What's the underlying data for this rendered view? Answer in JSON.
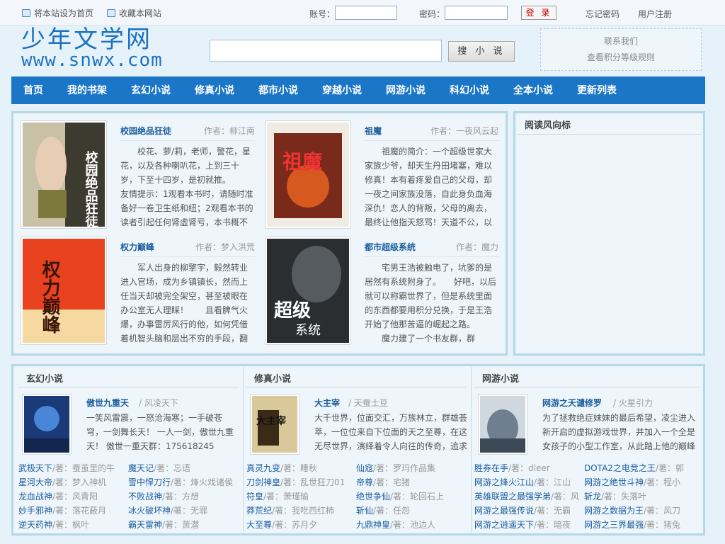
{
  "topbar": {
    "set_home": "将本站设为首页",
    "bookmark": "收藏本网站",
    "account_label": "账号：",
    "password_label": "密码：",
    "login": "登 录",
    "forgot": "忘记密码",
    "register": "用户注册"
  },
  "logo": {
    "cn": "少年文学网",
    "en": "www.snwx.com"
  },
  "search": {
    "value": "",
    "button": "搜 小 说"
  },
  "topright": {
    "line1": "联系我们",
    "line2": "查看积分等级规则"
  },
  "nav": [
    "首页",
    "我的书架",
    "玄幻小说",
    "修真小说",
    "都市小说",
    "穿越小说",
    "网游小说",
    "科幻小说",
    "全本小说",
    "更新列表"
  ],
  "featured": [
    {
      "title": "校园绝品狂徒",
      "author": "作者：柳江南",
      "desc": "　　校花、萝/莉，老师，警花，星花，以及各种喇叭花，上到三十岁，下至十四岁，是初就推。\n友情提示：1观看本书时，请随时准备好一卷卫生纸和纽；2观看本书的读者引起任何肾虚肾亏，本书概不"
    },
    {
      "title": "祖魔",
      "author": "作者：一夜风云起",
      "desc": "　　祖魔的简介：一个超级世家大家族少爷，却天生丹田堵塞，难以修真！本有着疼爱自己的父母，却一夜之间家族没落，自此身负血海深仇！恋人的背叛，父母的离去，最终让他指天怒骂！天道不公，以"
    },
    {
      "title": "权力巅峰",
      "author": "作者：梦入洪荒",
      "desc": "　　军人出身的柳擎宇，毅然转业进入官场，成为乡镇镇长，然而上任当天却被完全架空，甚至被眼在办公室无人理睬！　　且看脾气火爆，办事雷厉风行的他，如何凭借着机智头脑和层出不穷的手段，翻"
    },
    {
      "title": "都市超级系统",
      "author": "作者：魔力",
      "desc": "　　宅男王浩被触电了，坑爹的是居然有系统附身了。　　好吧，以后就可以称霸世界了，但是系统里面的东西都要用积分兑换，于是王浩开始了他那苦逼的崛起之路。\n　　魔力建了一个书友群，群"
    }
  ],
  "sidebar": {
    "title": "阅读风向标"
  },
  "sections": [
    {
      "title": "玄幻小说",
      "top": {
        "title": "傲世九重天",
        "author": "/ 风凌天下",
        "desc": "一笑风雷震，一怒沧海寒；一手破苍穹，一剑舞长天！ 一人一剑，傲世九重天！ 傲世一重天群：175618245（VIP订阅"
      },
      "list": [
        {
          "name": "武极天下",
          "author": "/著：蚕茧里的牛"
        },
        {
          "name": "魔天记",
          "author": "/著：忘语"
        },
        {
          "name": "星河大帝",
          "author": "/著：梦入神机"
        },
        {
          "name": "雪中悍刀行",
          "author": "/著：烽火戏诸侯"
        },
        {
          "name": "龙血战神",
          "author": "/著：风青阳"
        },
        {
          "name": "不败战神",
          "author": "/著：方想"
        },
        {
          "name": "妙手邪神",
          "author": "/著：落花蔽月"
        },
        {
          "name": "冰火破坏神",
          "author": "/著：无罪"
        },
        {
          "name": "逆天药神",
          "author": "/著：枫叶"
        },
        {
          "name": "霸天雷神",
          "author": "/著：萧潜"
        }
      ]
    },
    {
      "title": "修真小说",
      "top": {
        "title": "大主宰",
        "author": "/ 天蚕土豆",
        "desc": "大千世界，位面交汇，万族林立，群雄荟萃，一位位来自下位面的天之至尊，在这无尽世界，演绎着令人向往的传奇，追求"
      },
      "list": [
        {
          "name": "真灵九变",
          "author": "/著：睡秋"
        },
        {
          "name": "仙寇",
          "author": "/著：罗玛作品集"
        },
        {
          "name": "刀剑神皇",
          "author": "/著：乱世狂刀01"
        },
        {
          "name": "帝尊",
          "author": "/著：宅猪"
        },
        {
          "name": "符皇",
          "author": "/著：萧瑾瑜"
        },
        {
          "name": "绝世争仙",
          "author": "/著：轮回石上"
        },
        {
          "name": "莽荒纪",
          "author": "/著：我吃西红柿"
        },
        {
          "name": "斩仙",
          "author": "/著：任怨"
        },
        {
          "name": "大至尊",
          "author": "/著：苏月夕"
        },
        {
          "name": "九鼎神皇",
          "author": "/著：池边人"
        }
      ]
    },
    {
      "title": "网游小说",
      "top": {
        "title": "网游之天谴修罗",
        "author": "/ 火星引力",
        "desc": "为了拯救绝症妹妹的最后希望，凌尘进入新开启的虚拟游戏世界，并加入一个全是女孩子的小型工作室，从此踏上他的巅峰"
      },
      "list": [
        {
          "name": "胜券在手",
          "author": "/著：dleer"
        },
        {
          "name": "DOTA2之电竞之王",
          "author": "/著：郭"
        },
        {
          "name": "网游之烽火江山",
          "author": "/著：江山"
        },
        {
          "name": "网游之绝世斗神",
          "author": "/著：程小"
        },
        {
          "name": "英雄联盟之最强学弟",
          "author": "/著：风"
        },
        {
          "name": "斩龙",
          "author": "/著：失落叶"
        },
        {
          "name": "网游之最强传说",
          "author": "/著：无霸"
        },
        {
          "name": "网游之数据为王",
          "author": "/著：风刀"
        },
        {
          "name": "网游之逍遥天下",
          "author": "/著：暗夜"
        },
        {
          "name": "网游之三界最强",
          "author": "/著：猪兔"
        }
      ]
    }
  ]
}
